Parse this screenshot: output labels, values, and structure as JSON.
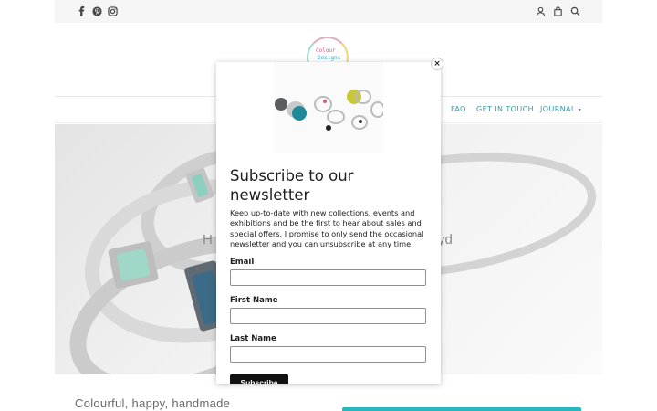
{
  "topbar": {
    "social_icons": [
      "facebook-icon",
      "pinterest-icon",
      "instagram-icon"
    ],
    "utility_icons": [
      "user-icon",
      "bag-icon",
      "search-icon"
    ]
  },
  "logo": {
    "line1": "Colour",
    "line2": "Designs"
  },
  "nav": {
    "items": [
      "FAQ",
      "GET IN TOUCH",
      "JOURNAL"
    ]
  },
  "hero": {
    "title_left": "H",
    "title_right": "yd"
  },
  "section": {
    "tagline": "Colourful, happy, handmade"
  },
  "modal": {
    "close_label": "×",
    "title": "Subscribe to our newsletter",
    "description": "Keep up-to-date with new collections, events and exhibitions and be the first to hear about sales and special offers. I promise to only send the occasional newsletter and you can unsubscribe at any time.",
    "fields": [
      {
        "label": "Email",
        "value": ""
      },
      {
        "label": "First Name",
        "value": ""
      },
      {
        "label": "Last Name",
        "value": ""
      }
    ],
    "submit_label": "Subscribe"
  },
  "colors": {
    "accent": "#27b7bd",
    "nav_text": "#3a9aa3",
    "button": "#111111"
  }
}
